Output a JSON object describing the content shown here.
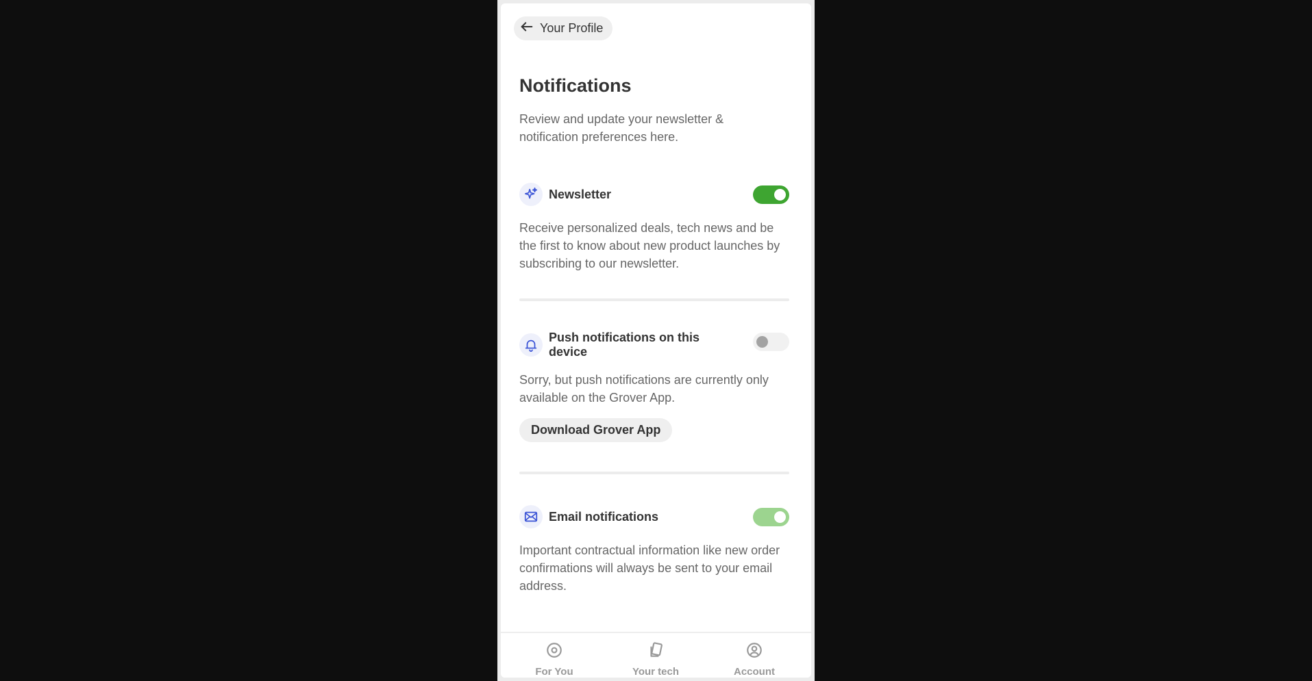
{
  "header": {
    "back_label": "Your Profile"
  },
  "page": {
    "title": "Notifications",
    "intro": "Review and update your newsletter & notification preferences here."
  },
  "sections": {
    "newsletter": {
      "label": "Newsletter",
      "description": "Receive personalized deals, tech news and be the first to know about new product launches by subscribing to our newsletter.",
      "toggle_state": "on"
    },
    "push": {
      "label": "Push notifications on this device",
      "description": "Sorry, but push notifications are currently only available on the Grover App.",
      "button_label": "Download Grover App",
      "toggle_state": "off"
    },
    "email": {
      "label": "Email notifications",
      "description": "Important contractual information like new order confirmations will always be sent to your email address.",
      "toggle_state": "on (disabled)"
    }
  },
  "bottom_nav": {
    "items": [
      {
        "label": "For You",
        "icon": "target-icon"
      },
      {
        "label": "Your tech",
        "icon": "cards-icon"
      },
      {
        "label": "Account",
        "icon": "user-circle-icon"
      }
    ]
  },
  "colors": {
    "toggle_on": "#3ea531",
    "toggle_on_disabled": "#9cd48f",
    "icon_accent": "#3b54d6",
    "background": "#0e0e0e"
  }
}
